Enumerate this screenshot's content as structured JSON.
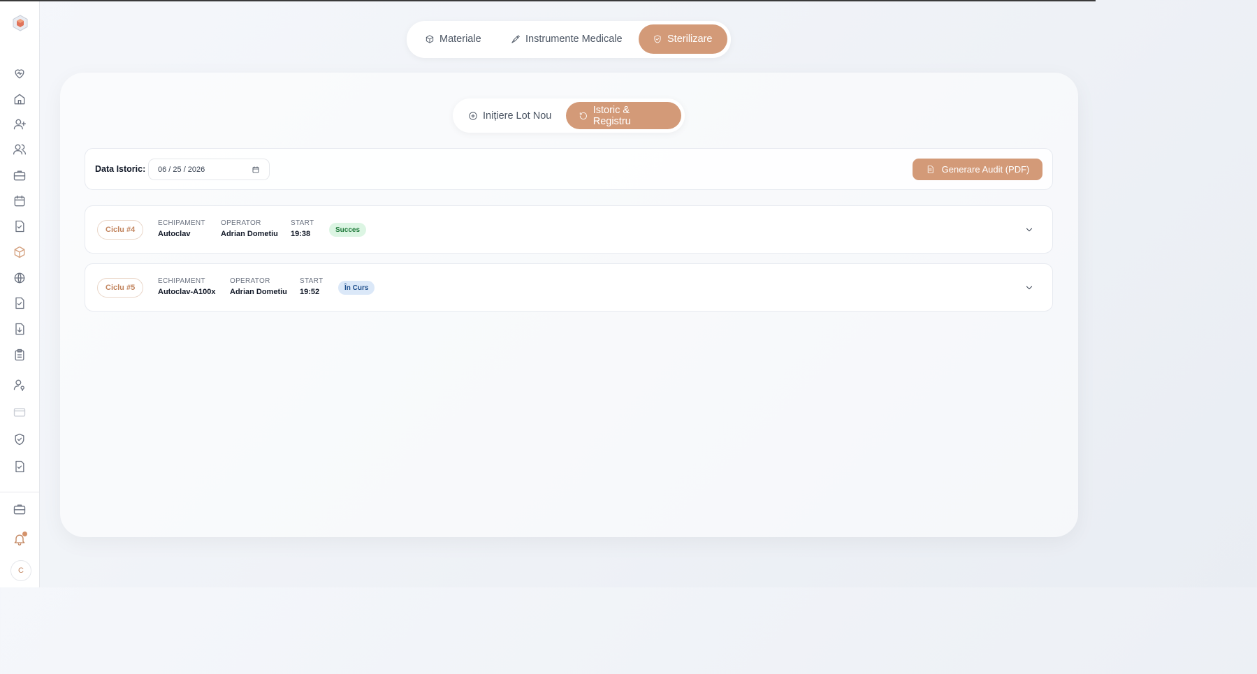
{
  "main_tabs": [
    {
      "label": "Materiale",
      "icon": "box-icon",
      "active": false
    },
    {
      "label": "Instrumente Medicale",
      "icon": "syringe-icon",
      "active": false
    },
    {
      "label": "Sterilizare",
      "icon": "shield-icon",
      "active": true
    }
  ],
  "sub_tabs": [
    {
      "label": "Inițiere Lot Nou",
      "icon": "plus-circle-icon",
      "active": false
    },
    {
      "label": "Istoric & Registru",
      "icon": "history-icon",
      "active": true
    }
  ],
  "filter": {
    "label": "Data Istoric:",
    "date_value": "06 / 25 / 2026",
    "audit_button": "Generare Audit (PDF)"
  },
  "cycles": [
    {
      "id": "Ciclu #4",
      "fields": [
        {
          "label": "ECHIPAMENT",
          "value": "Autoclav"
        },
        {
          "label": "OPERATOR",
          "value": "Adrian Dometiu"
        },
        {
          "label": "START",
          "value": "19:38"
        }
      ],
      "status": "Succes"
    },
    {
      "id": "Ciclu #5",
      "fields": [
        {
          "label": "ECHIPAMENT",
          "value": "Autoclav-A100x"
        },
        {
          "label": "OPERATOR",
          "value": "Adrian Dometiu"
        },
        {
          "label": "START",
          "value": "19:52"
        }
      ],
      "status": "În Curs"
    }
  ],
  "sidebar": {
    "icons": [
      "heart-pulse-icon",
      "home-icon",
      "user-plus-icon",
      "users-icon",
      "briefcase-icon",
      "calendar-icon",
      "file-check-icon",
      "package-icon",
      "globe-icon",
      "file-check-icon",
      "file-download-icon",
      "clipboard-list-icon",
      "user-key-icon",
      "credit-card-icon",
      "shield-check-icon",
      "file-check-icon",
      "briefcase-icon",
      "bell-icon"
    ],
    "avatar_initial": "C"
  },
  "colors": {
    "accent": "#d39a78",
    "success_bg": "#dcf5e3",
    "running_bg": "#dbe8f8"
  }
}
